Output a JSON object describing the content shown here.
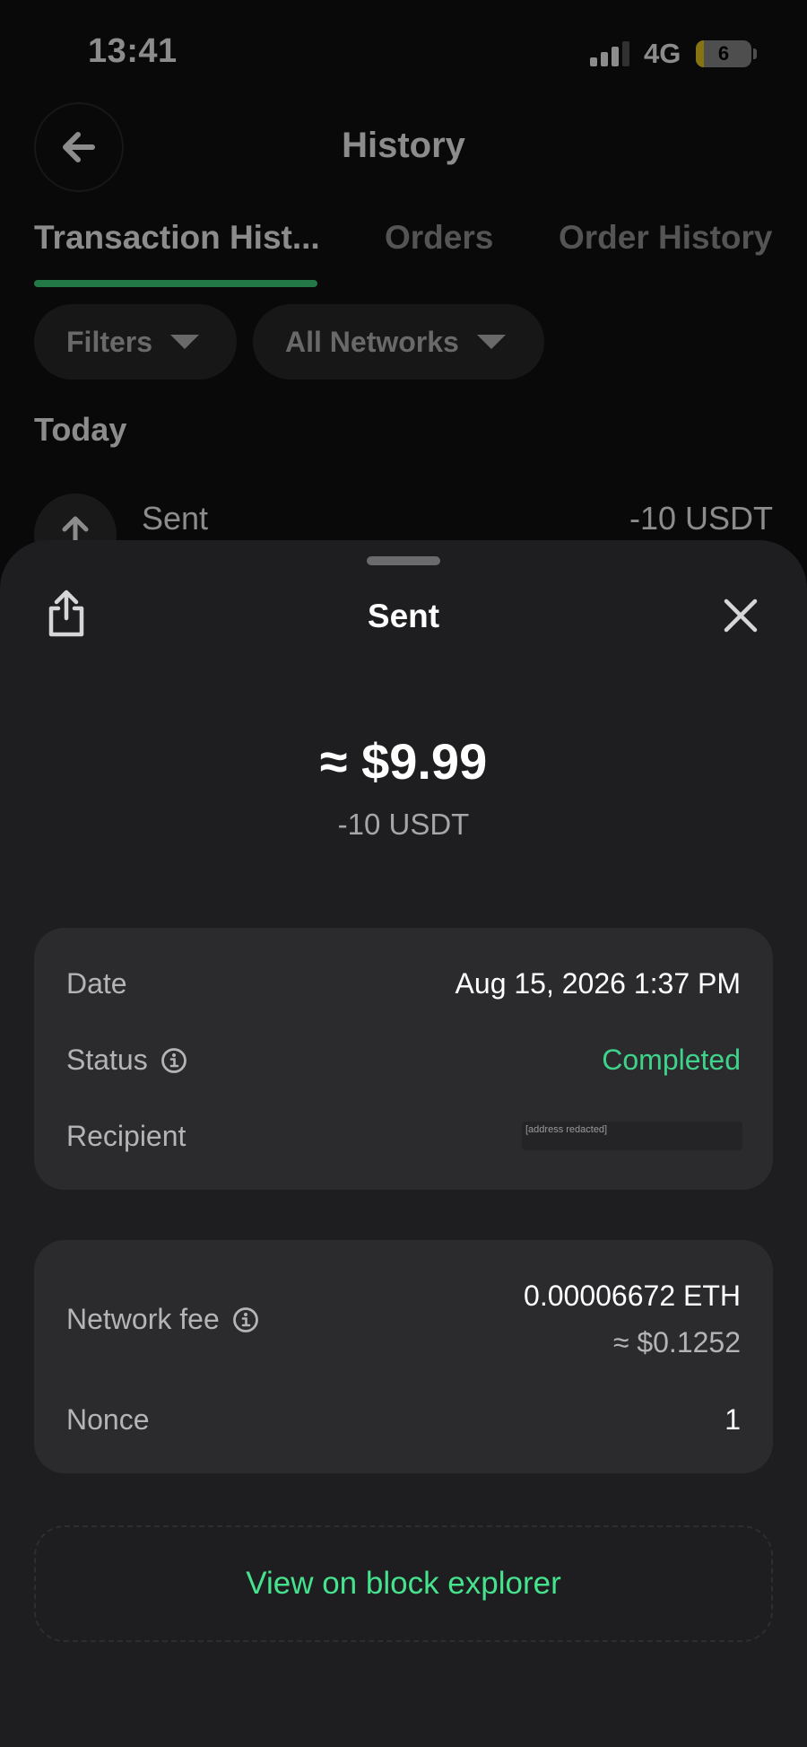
{
  "status_bar": {
    "time": "13:41",
    "network": "4G",
    "battery_level": "6",
    "battery_fraction": 0.15
  },
  "header": {
    "title": "History",
    "back_icon": "arrow-left-icon"
  },
  "tabs": [
    {
      "label": "Transaction Hist...",
      "active": true
    },
    {
      "label": "Orders",
      "active": false
    },
    {
      "label": "Order History",
      "active": false
    }
  ],
  "filters": {
    "filters_label": "Filters",
    "networks_label": "All Networks"
  },
  "list": {
    "section": "Today",
    "item": {
      "label": "Sent",
      "amount": "-10 USDT",
      "icon": "arrow-up-icon"
    }
  },
  "sheet": {
    "title": "Sent",
    "share_icon": "share-icon",
    "close_icon": "close-icon",
    "amount_usd": "≈ $9.99",
    "amount_token": "-10 USDT",
    "details": {
      "date_label": "Date",
      "date_value": "Aug 15, 2026 1:37 PM",
      "status_label": "Status",
      "status_value": "Completed",
      "recipient_label": "Recipient",
      "recipient_value": "[address redacted]"
    },
    "fee": {
      "fee_label": "Network fee",
      "fee_eth": "0.00006672 ETH",
      "fee_usd": "≈ $0.1252",
      "nonce_label": "Nonce",
      "nonce_value": "1"
    },
    "explorer_label": "View on block explorer"
  },
  "colors": {
    "accent_green": "#3fdc80",
    "status_green": "#3fd28a",
    "sheet_bg": "#1e1e20",
    "card_bg": "#2b2b2e"
  }
}
